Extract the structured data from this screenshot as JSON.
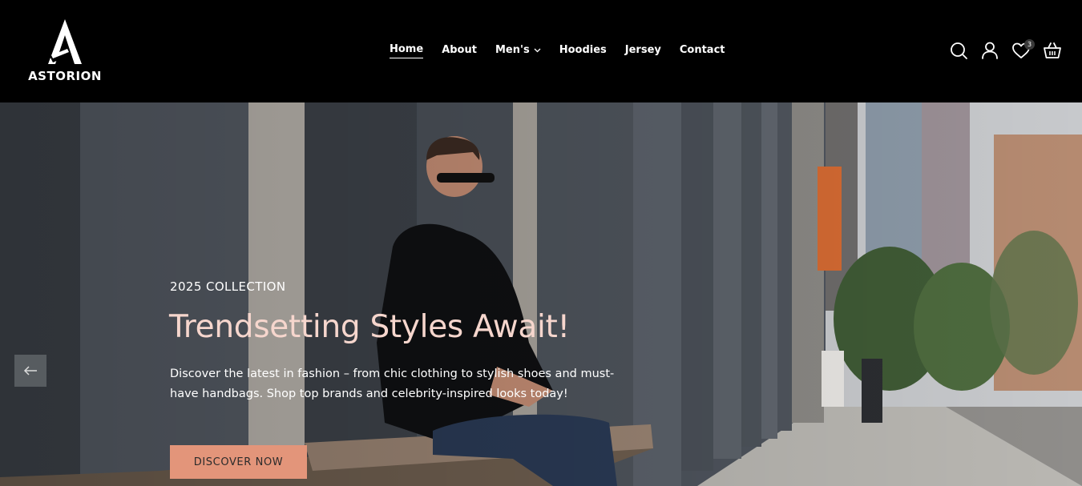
{
  "brand": {
    "name": "ASTORION"
  },
  "nav": {
    "items": [
      {
        "label": "Home",
        "active": true
      },
      {
        "label": "About"
      },
      {
        "label": "Men's",
        "has_dropdown": true
      },
      {
        "label": "Hoodies"
      },
      {
        "label": "Jersey"
      },
      {
        "label": "Contact"
      }
    ]
  },
  "header_icons": {
    "search": "search-icon",
    "account": "user-icon",
    "wishlist": "heart-icon",
    "wishlist_count": "3",
    "cart": "basket-icon"
  },
  "hero": {
    "eyebrow": "2025 COLLECTION",
    "headline": "Trendsetting Styles Await!",
    "description": "Discover the latest in fashion – from chic clothing to stylish shoes and must-have handbags. Shop top brands and celebrity-inspired looks today!",
    "cta_label": "DISCOVER NOW",
    "prev_icon": "arrow-left-icon"
  },
  "colors": {
    "header_bg": "#000000",
    "headline": "#f6d6cd",
    "cta_bg": "#e3957a",
    "nav_text": "#ffffff"
  }
}
